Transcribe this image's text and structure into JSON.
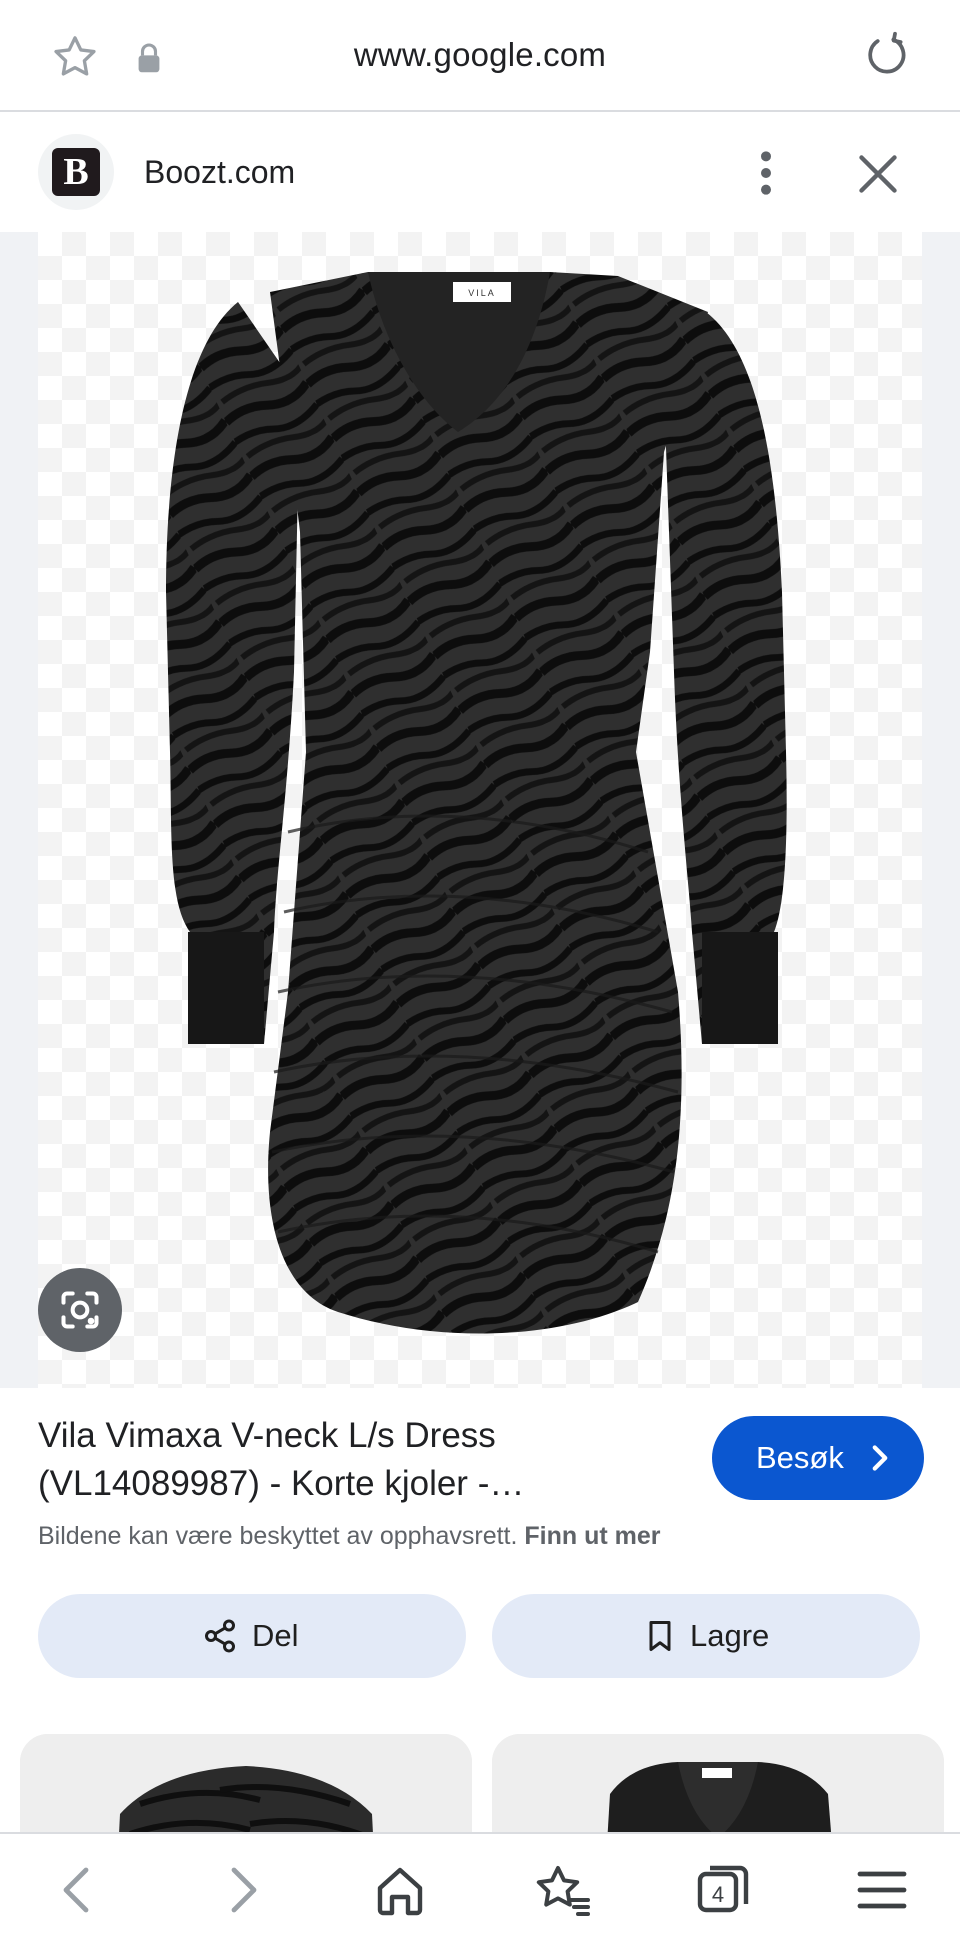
{
  "browser": {
    "url": "www.google.com",
    "tab_count": "4"
  },
  "source": {
    "logo_letter": "B",
    "name": "Boozt.com"
  },
  "image": {
    "brand_label": "VILA"
  },
  "result": {
    "title_line1": "Vila Vimaxa V-neck L/s Dress",
    "title_line2": "(VL14089987) - Korte kjoler -…",
    "visit_label": "Besøk",
    "notice": "Bildene kan være beskyttet av opphavsrett.",
    "notice_link": "Finn ut mer"
  },
  "actions": {
    "share_label": "Del",
    "save_label": "Lagre"
  },
  "colors": {
    "accent": "#0b57d0",
    "pill_bg": "#e3eaf7",
    "lens_bg": "#5f6368"
  }
}
